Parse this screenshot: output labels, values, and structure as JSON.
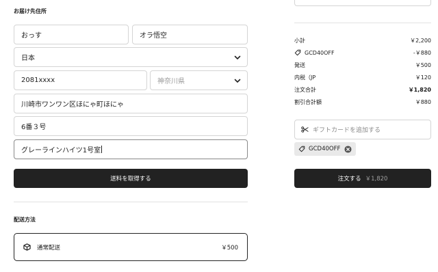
{
  "address": {
    "title": "お届け先住所",
    "first_name": "おっす",
    "last_name": "オラ悟空",
    "country": "日本",
    "postal_code": "2081xxxx",
    "prefecture_placeholder": "神奈川県",
    "city_address": "川崎市ワンワン区ほにゃ町ほにゃ",
    "street": "6番３号",
    "building": "グレーラインハイツ1号室",
    "get_shipping_button": "送料を取得する"
  },
  "shipping": {
    "title": "配送方法",
    "method_label": "通常配送",
    "method_price": "￥500"
  },
  "summary": {
    "rows": [
      {
        "label": "小計",
        "value": "￥2,200"
      },
      {
        "label": "GCD40OFF",
        "value": "-￥880"
      },
      {
        "label": "発送",
        "value": "￥500"
      },
      {
        "label": "内税（JP",
        "value": "￥120"
      },
      {
        "label": "注文合計",
        "value": "￥1,820"
      },
      {
        "label": "割引合計額",
        "value": "￥880"
      }
    ],
    "gift_placeholder": "ギフトカードを追加する",
    "applied_code": "GCD40OFF",
    "order_button_label": "注文する",
    "order_button_total": "￥1,820"
  },
  "icons": {
    "chevron": "chevron-down-icon",
    "tag": "tag-icon",
    "scissors": "scissors-icon",
    "box": "box-icon",
    "remove": "close-circle-icon"
  }
}
